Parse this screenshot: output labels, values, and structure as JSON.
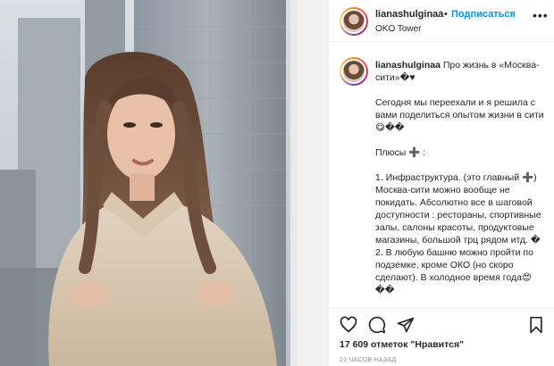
{
  "post": {
    "username": "lianashulginaa",
    "separator": "•",
    "follow_label": "Подписаться",
    "location": "OKO Tower",
    "more_icon": "more-horizontal-icon"
  },
  "caption": {
    "username": "lianashulginaa",
    "first_line": "Про жизнь в «Москва-сити»�♥",
    "paragraph_1": "Сегодня мы переехали и я решила с вами поделиться опытом жизни в сити😋��",
    "pluses": "Плюсы ➕ :",
    "paragraph_3": "1. Инфраструктура. (это главный ➕) Москва-сити можно вообще не покидать. Абсолютно все в шаговой доступности : рестораны, спортивные залы, салоны красоты, продуктовые магазины, большой трц рядом итд. �",
    "paragraph_4": "2. В любую башню можно пройти по подземке, кроме ОКО (но скоро сделают). В холодное время года😍 ��"
  },
  "actions": {
    "like_icon": "heart-icon",
    "comment_icon": "comment-icon",
    "share_icon": "share-icon",
    "save_icon": "bookmark-icon"
  },
  "likes_text": "17 609 отметок \"Нравится\"",
  "timestamp": "21 ЧАСОВ НАЗАД"
}
